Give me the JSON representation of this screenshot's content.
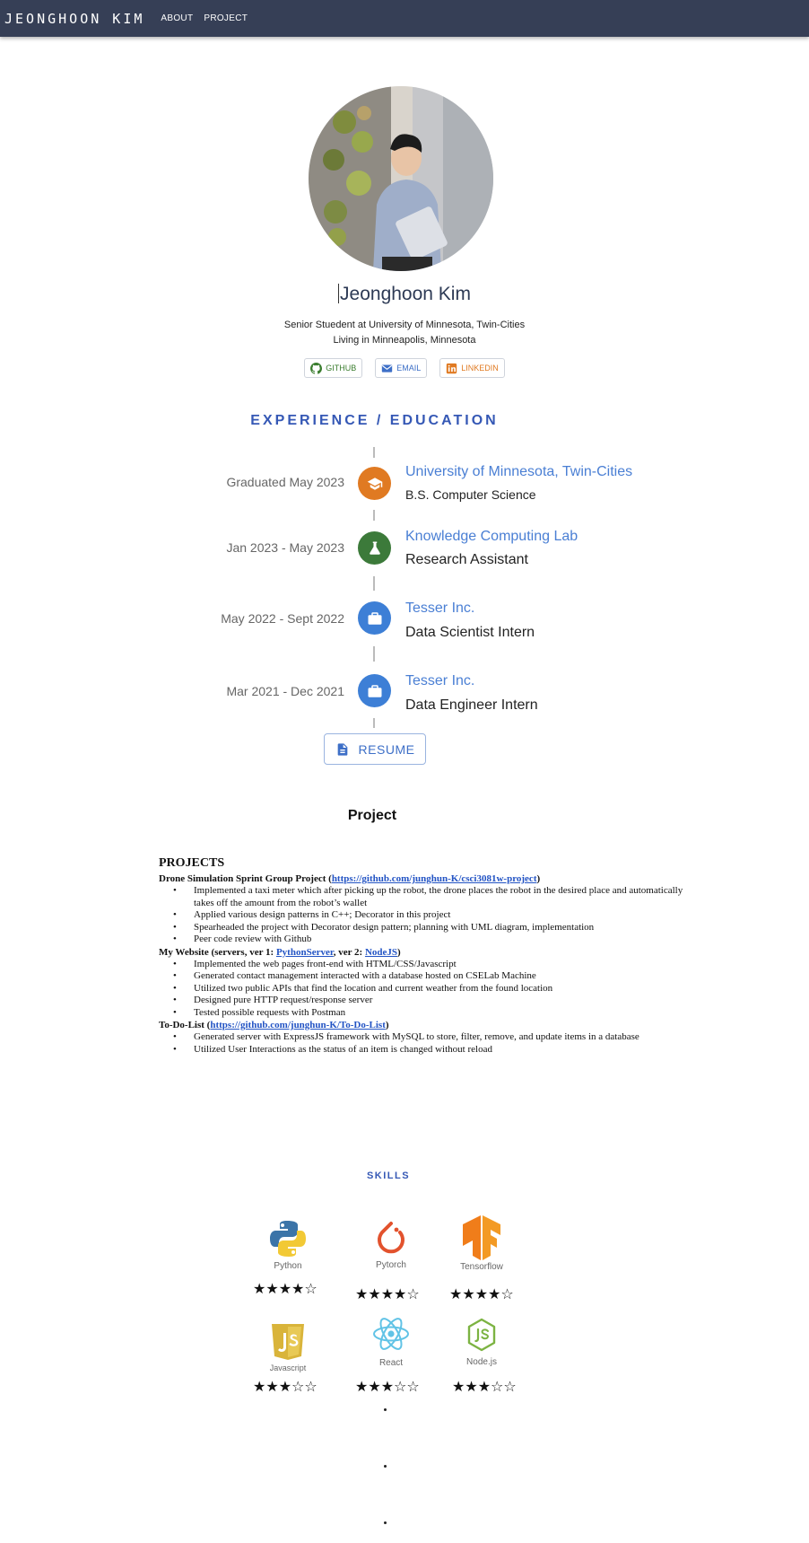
{
  "nav": {
    "brand": "JEONGHOON KIM",
    "links": [
      "ABOUT",
      "PROJECT"
    ]
  },
  "profile": {
    "name": "Jeonghoon Kim",
    "subtitle": "Senior Stuedent at University of Minnesota, Twin-Cities",
    "location": "Living in Minneapolis, Minnesota",
    "links": [
      {
        "label": "GITHUB",
        "icon": "github-icon",
        "color": "#3a7d2e"
      },
      {
        "label": "EMAIL",
        "icon": "email-icon",
        "color": "#3d6fc7"
      },
      {
        "label": "LINKEDIN",
        "icon": "linkedin-icon",
        "color": "#e07a22"
      }
    ]
  },
  "experience": {
    "title": "EXPERIENCE / EDUCATION",
    "items": [
      {
        "date": "Graduated May 2023",
        "org": "University of Minnesota, Twin-Cities",
        "role": "B.S. Computer Science",
        "icon": "graduation-cap-icon",
        "color": "#e07a22"
      },
      {
        "date": "Jan 2023 - May 2023",
        "org": "Knowledge Computing Lab",
        "role": "Research Assistant",
        "icon": "flask-icon",
        "color": "#3c7a3a"
      },
      {
        "date": "May 2022 - Sept 2022",
        "org": "Tesser Inc.",
        "role": "Data Scientist Intern",
        "icon": "briefcase-icon",
        "color": "#3d7fd6"
      },
      {
        "date": "Mar 2021 - Dec 2021",
        "org": "Tesser Inc.",
        "role": "Data Engineer Intern",
        "icon": "briefcase-icon",
        "color": "#3d7fd6"
      }
    ],
    "resume_label": "RESUME"
  },
  "projects": {
    "heading": "Project",
    "doc_title": "PROJECTS",
    "p1": {
      "title_pre": "Drone Simulation Sprint Group Project (",
      "link": "https://github.com/junghun-K/csci3081w-project",
      "title_post": ")",
      "bullets": [
        "Implemented a taxi meter which after picking up the robot, the drone places the robot in the desired place and automatically takes off the amount from the robot’s wallet",
        "Applied various design patterns in C++; Decorator in this project",
        "Spearheaded the project with Decorator design pattern; planning with UML diagram, implementation",
        "Peer code review with Github"
      ]
    },
    "p2": {
      "title_pre": "My Website (servers, ver 1: ",
      "link1": "PythonServer",
      "title_mid": ", ver 2: ",
      "link2": "NodeJS",
      "title_post": ")",
      "bullets": [
        "Implemented the web pages front-end with HTML/CSS/Javascript",
        "Generated contact management interacted with a database hosted on CSELab Machine",
        "Utilized two public APIs that find the location and current weather from the found location",
        "Designed pure HTTP request/response server",
        "Tested possible requests with Postman"
      ]
    },
    "p3": {
      "title_pre": "To-Do-List (",
      "link": "https://github.com/junghun-K/To-Do-List",
      "title_post": ")",
      "bullets": [
        "Generated server with ExpressJS framework with MySQL to store, filter, remove, and update items in a database",
        "Utilized User Interactions as the status of an item is changed without reload"
      ]
    }
  },
  "skills": {
    "title": "SKILLS",
    "items": [
      {
        "name": "Python",
        "stars": "★★★★☆",
        "rating": 4
      },
      {
        "name": "Pytorch",
        "stars": "★★★★☆",
        "rating": 4
      },
      {
        "name": "Tensorflow",
        "stars": "★★★★☆",
        "rating": 4
      },
      {
        "name": "Javascript",
        "stars": "★★★☆☆",
        "rating": 3
      },
      {
        "name": "React",
        "stars": "★★★☆☆",
        "rating": 3
      },
      {
        "name": "Node.js",
        "stars": "★★★☆☆",
        "rating": 3
      }
    ]
  }
}
